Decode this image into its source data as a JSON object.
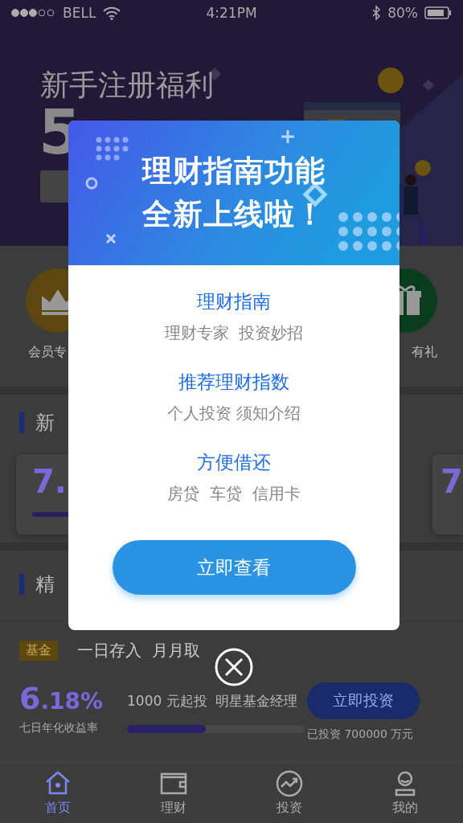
{
  "status_bar": {
    "carrier": "BELL",
    "time": "4:21PM",
    "battery": "80%"
  },
  "banner": {
    "title": "新手注册福利",
    "amount": "5"
  },
  "shortcuts": [
    {
      "kind": "crown",
      "label": "会员专"
    },
    {
      "kind": "gift",
      "label": "有礼"
    }
  ],
  "newcomer": {
    "title": "新",
    "cards": [
      {
        "rate": "7."
      },
      {
        "rate": "7"
      }
    ]
  },
  "featured": {
    "title": "精",
    "fund": {
      "tag": "基金",
      "title": "一日存入  月月取",
      "rate_int": "6",
      "rate_dec": ".18%",
      "rate_label": "七日年化收益率",
      "terms": "1000 元起投  明星基金经理",
      "level": 0.44,
      "button": "立即投资",
      "invested": "已投资 700000 万元"
    }
  },
  "tabs": [
    {
      "kind": "home",
      "label": "首页",
      "selected": true
    },
    {
      "kind": "wallet",
      "label": "理财",
      "selected": false
    },
    {
      "kind": "chart",
      "label": "投资",
      "selected": false
    },
    {
      "kind": "user",
      "label": "我的",
      "selected": false
    }
  ],
  "modal": {
    "title_lines": [
      "理财指南功能",
      "全新上线啦！"
    ],
    "features": [
      {
        "title": "理财指南",
        "subtitle": "理财专家  投资妙招"
      },
      {
        "title": "推荐理财指数",
        "subtitle": "个人投资 须知介绍"
      },
      {
        "title": "方便借还",
        "subtitle": "房贷  车贷  信用卡"
      }
    ],
    "button": "立即查看"
  }
}
